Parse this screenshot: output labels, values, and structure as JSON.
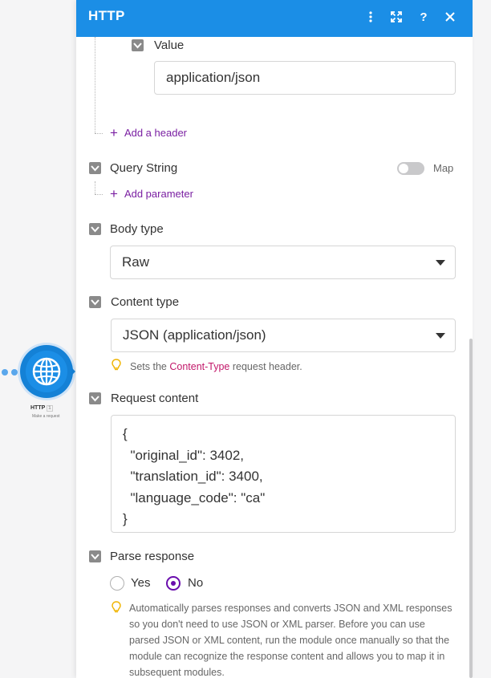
{
  "canvas": {
    "module_name": "HTTP",
    "module_badge": "1",
    "module_subtitle": "Make a request"
  },
  "panel": {
    "title": "HTTP",
    "header_icons": [
      "more-vertical-icon",
      "expand-icon",
      "help-icon",
      "close-icon"
    ]
  },
  "headers": {
    "value_label": "Value",
    "value": "application/json",
    "add_header": "Add a header"
  },
  "query_string": {
    "label": "Query String",
    "map_label": "Map",
    "add_parameter": "Add parameter"
  },
  "body_type": {
    "label": "Body type",
    "value": "Raw"
  },
  "content_type": {
    "label": "Content type",
    "value": "JSON (application/json)",
    "hint_prefix": "Sets the ",
    "hint_code": "Content-Type",
    "hint_suffix": " request header."
  },
  "request_content": {
    "label": "Request content",
    "value": "{\n  \"original_id\": 3402,\n  \"translation_id\": 3400,\n  \"language_code\": \"ca\"\n}"
  },
  "parse_response": {
    "label": "Parse response",
    "yes": "Yes",
    "no": "No",
    "selected": "No",
    "hint": "Automatically parses responses and converts JSON and XML responses so you don't need to use JSON or XML parser. Before you can use parsed JSON or XML content, run the module once manually so that the module can recognize the response content and allows you to map it in subsequent modules."
  },
  "colors": {
    "header": "#1b8ee6",
    "link": "#7a1fa2",
    "radio_accent": "#6a0dad"
  }
}
